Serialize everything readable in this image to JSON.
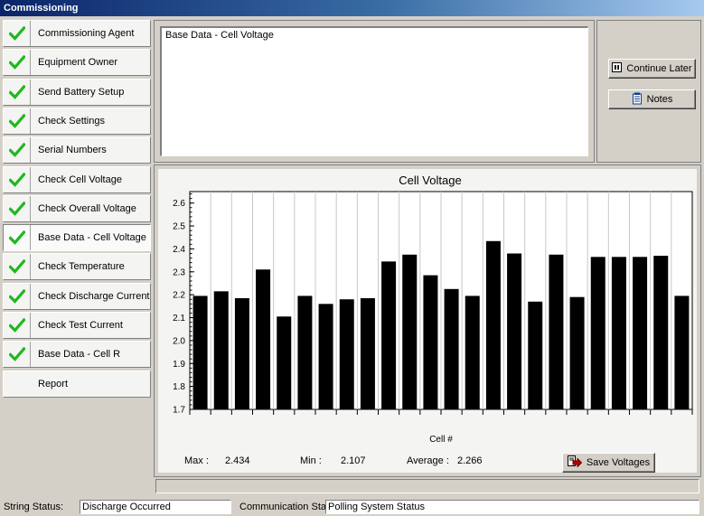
{
  "window": {
    "title": "Commissioning"
  },
  "sidebar": {
    "items": [
      {
        "label": "Commissioning Agent",
        "checked": true
      },
      {
        "label": "Equipment Owner",
        "checked": true
      },
      {
        "label": "Send Battery Setup",
        "checked": true
      },
      {
        "label": "Check Settings",
        "checked": true
      },
      {
        "label": "Serial Numbers",
        "checked": true
      },
      {
        "label": "Check Cell Voltage",
        "checked": true
      },
      {
        "label": "Check Overall Voltage",
        "checked": true
      },
      {
        "label": "Base Data - Cell Voltage",
        "checked": true,
        "active": true
      },
      {
        "label": "Check Temperature",
        "checked": true
      },
      {
        "label": "Check Discharge Current",
        "checked": true
      },
      {
        "label": "Check Test Current",
        "checked": true
      },
      {
        "label": "Base Data - Cell R",
        "checked": true
      },
      {
        "label": "Report",
        "checked": false
      }
    ]
  },
  "message": {
    "text": "Base Data - Cell Voltage"
  },
  "buttons": {
    "continue_later": "Continue Later",
    "notes": "Notes",
    "save_voltages": "Save Voltages"
  },
  "chart_data": {
    "type": "bar",
    "title": "Cell Voltage",
    "xlabel": "Cell #",
    "ylabel": "",
    "ylim": [
      1.7,
      2.65
    ],
    "yticks": [
      "1.7",
      "1.8",
      "1.9",
      "2.0",
      "2.1",
      "2.2",
      "2.3",
      "2.4",
      "2.5",
      "2.6"
    ],
    "values": [
      2.195,
      2.215,
      2.185,
      2.31,
      2.105,
      2.195,
      2.16,
      2.18,
      2.185,
      2.345,
      2.375,
      2.285,
      2.225,
      2.195,
      2.434,
      2.38,
      2.17,
      2.375,
      2.19,
      2.365,
      2.365,
      2.365,
      2.37,
      2.195
    ],
    "bar_color": "#000000",
    "grid": true
  },
  "stats": {
    "max_label": "Max :",
    "max_value": "2.434",
    "min_label": "Min :",
    "min_value": "2.107",
    "avg_label": "Average :",
    "avg_value": "2.266"
  },
  "status": {
    "string_label": "String Status:",
    "string_value": "Discharge Occurred",
    "comm_label": "Communication Status:",
    "comm_value": "Polling System Status"
  },
  "icons": {
    "check": "checkmark-icon",
    "pause": "pause-icon",
    "notes": "notepad-icon",
    "save": "save-arrow-icon"
  }
}
